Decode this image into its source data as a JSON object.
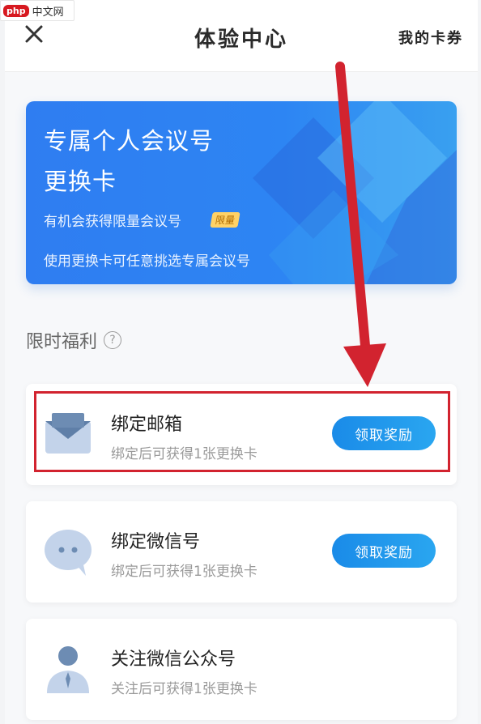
{
  "watermark": {
    "badge": "php",
    "text": "中文网"
  },
  "navbar": {
    "title": "体验中心",
    "right_link": "我的卡券",
    "close_icon": "close-icon"
  },
  "banner": {
    "title_line1": "专属个人会议号",
    "title_line2": "更换卡",
    "subtitle": "有机会获得限量会议号",
    "tag": "限量",
    "description": "使用更换卡可任意挑选专属会议号"
  },
  "section": {
    "label": "限时福利",
    "help_icon": "help-icon",
    "help_glyph": "?"
  },
  "tasks": [
    {
      "title": "绑定邮箱",
      "desc": "绑定后可获得1张更换卡",
      "button": "领取奖励",
      "icon": "envelope-icon"
    },
    {
      "title": "绑定微信号",
      "desc": "绑定后可获得1张更换卡",
      "button": "领取奖励",
      "icon": "chat-bubble-icon"
    },
    {
      "title": "关注微信公众号",
      "desc": "关注后可获得1张更换卡",
      "icon": "person-icon"
    }
  ],
  "colors": {
    "accent": "#1a8be8",
    "banner": "#2f7df1",
    "annotation": "#d2232f",
    "tag_bg": "#ffd266"
  }
}
